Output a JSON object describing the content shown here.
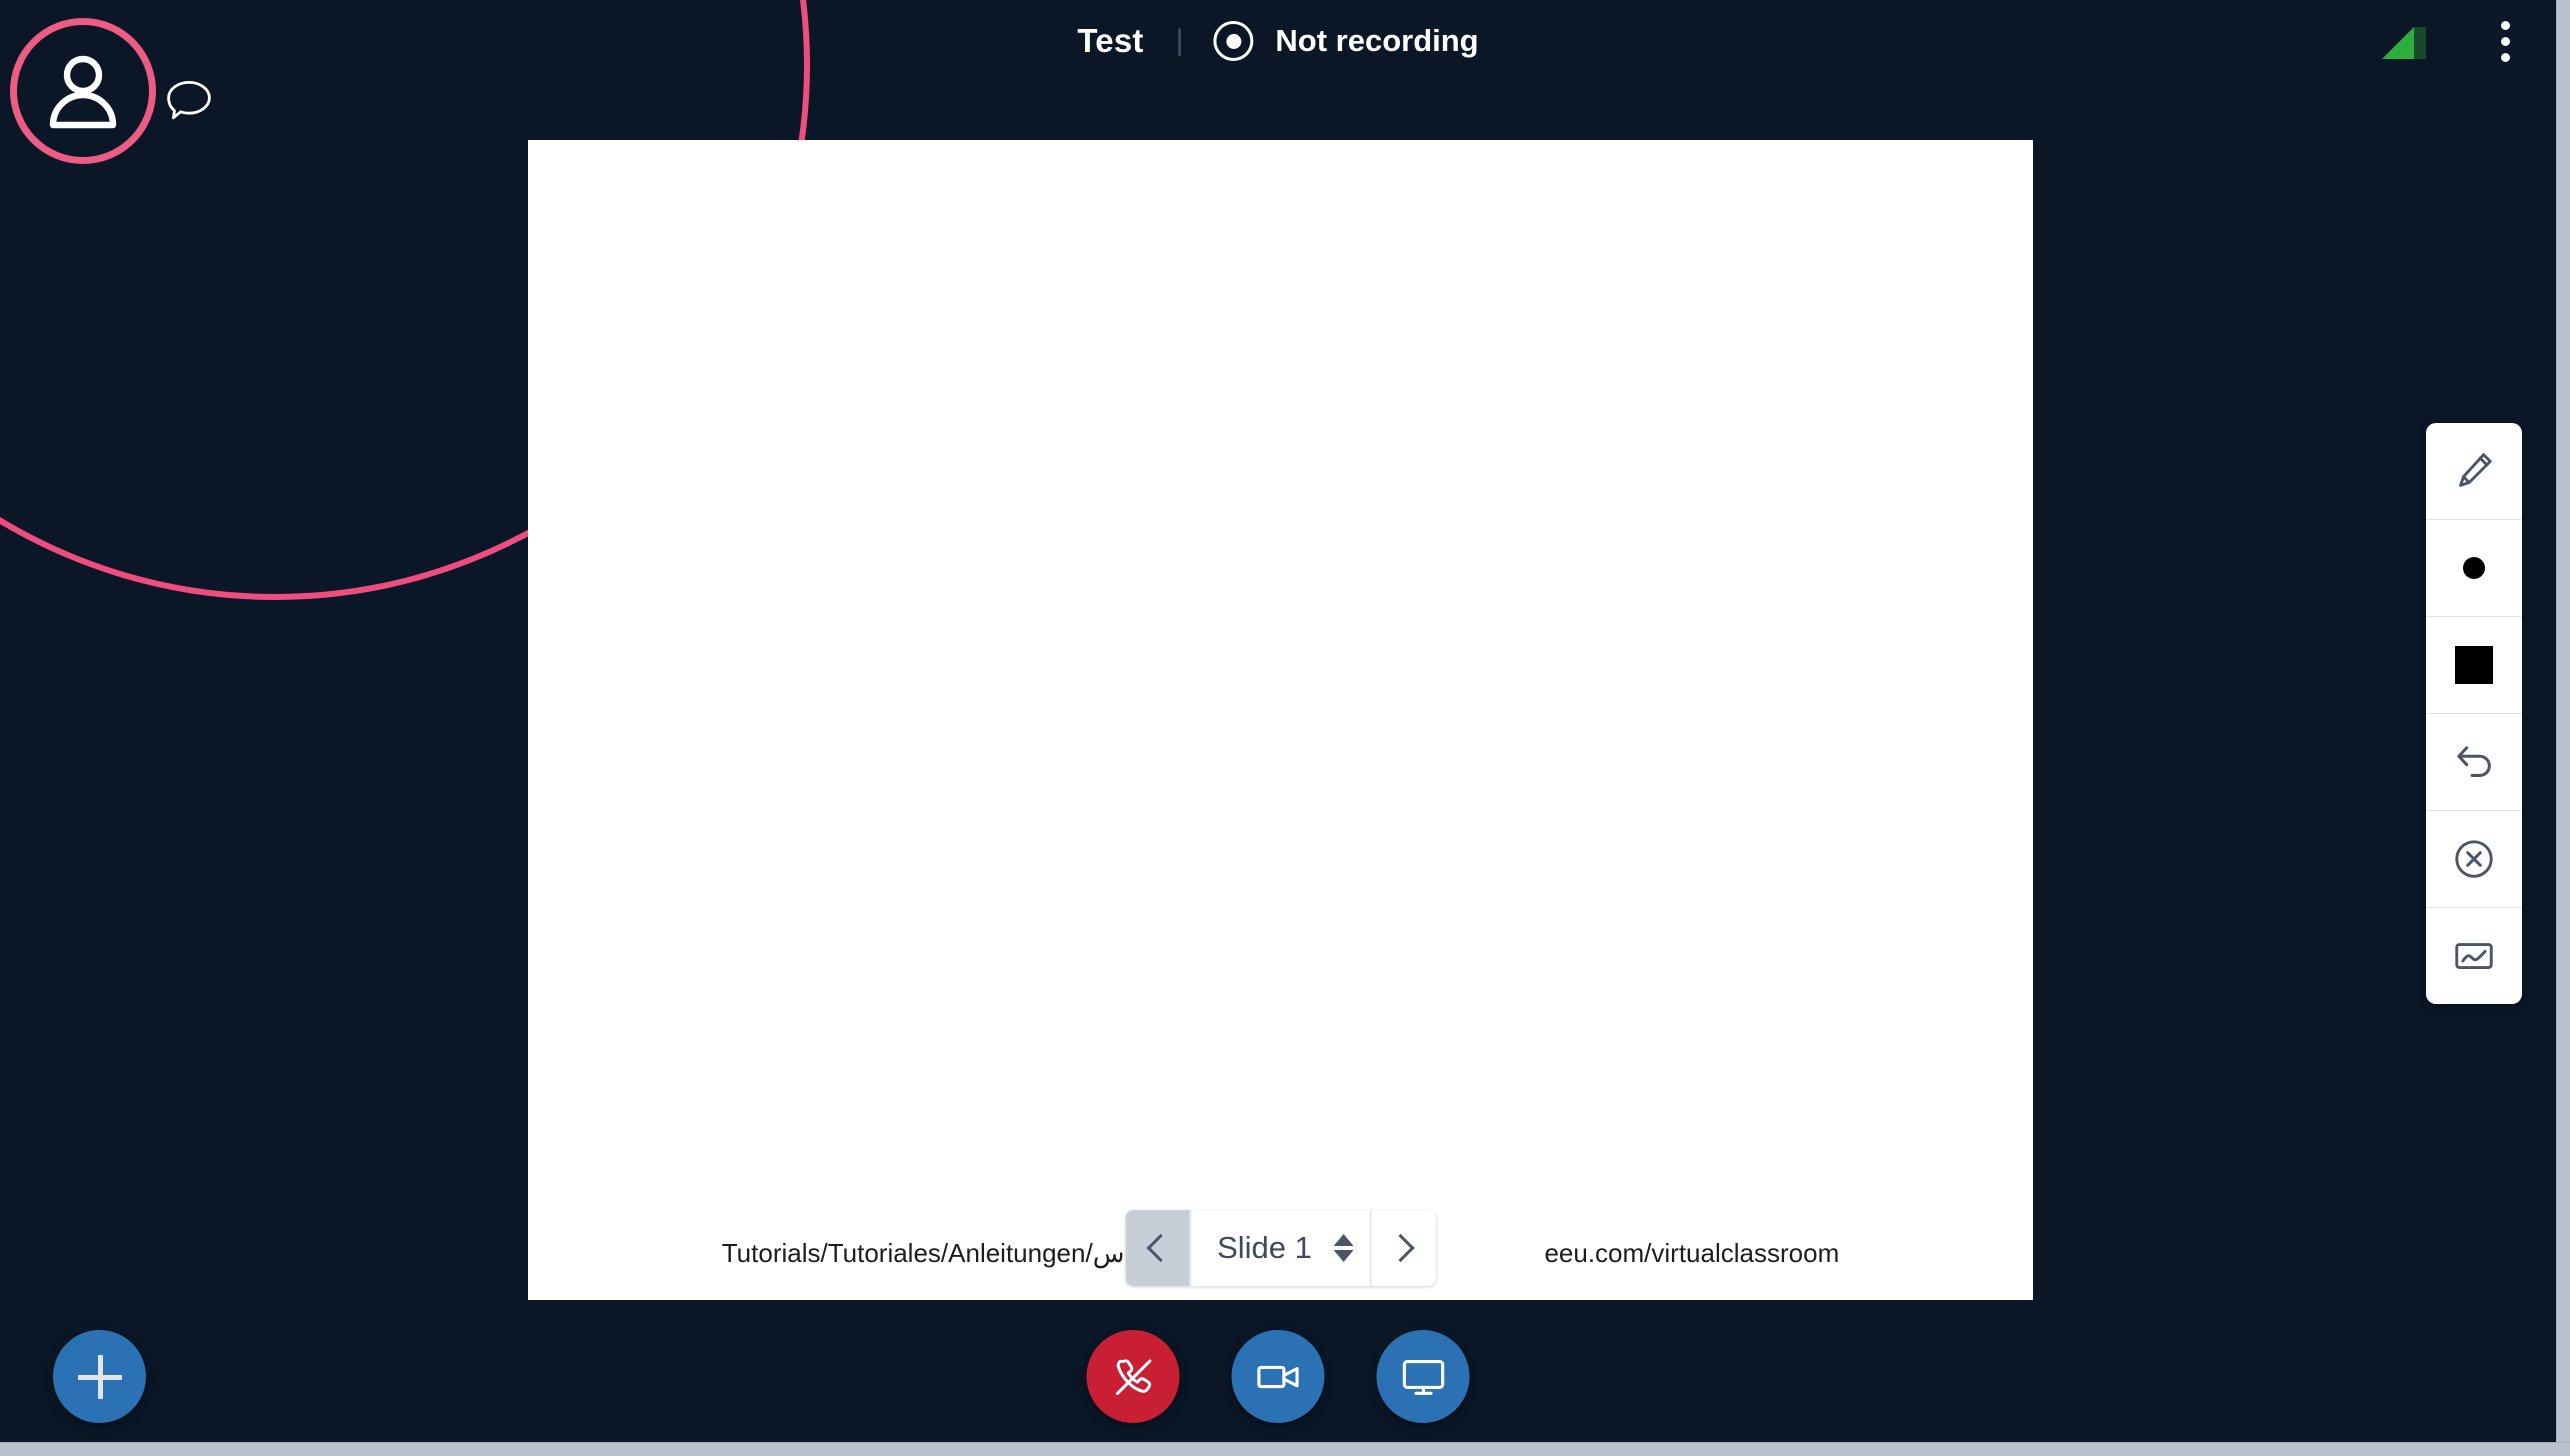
{
  "window": {
    "background_color": "#0b1727",
    "scrollbar_color": "#b9c2cc"
  },
  "header": {
    "meeting_title": "Test",
    "separator": "|",
    "recording_status": "Not recording",
    "recording_icon": "record-dot-icon",
    "signal_icon": "connection-signal-icon",
    "signal_color": "#2eae3c",
    "menu_icon": "kebab-menu-icon"
  },
  "user": {
    "avatar_icon": "person-icon",
    "avatar_ring_color": "#ed5c85",
    "chat_icon": "chat-bubble-icon"
  },
  "whiteboard": {
    "background_color": "#ffffff",
    "slide_text_left": "Tutorials/Tutoriales/Anleitungen/س",
    "slide_text_right": "eeu.com/virtualclassroom",
    "nav": {
      "prev_label": "Previous slide",
      "prev_icon": "chevron-left-icon",
      "next_label": "Next slide",
      "next_icon": "chevron-right-icon",
      "current_slide": "Slide 1",
      "stepper_icon": "up-down-stepper-icon"
    }
  },
  "toolbar": {
    "tools": [
      {
        "name": "pencil-tool",
        "icon": "pencil-icon",
        "label": "Pencil"
      },
      {
        "name": "thickness-tool",
        "icon": "dot-icon",
        "label": "Thickness",
        "value": "#000000"
      },
      {
        "name": "color-tool",
        "icon": "color-swatch-icon",
        "label": "Color",
        "value": "#000000"
      },
      {
        "name": "undo-tool",
        "icon": "undo-arrow-icon",
        "label": "Undo"
      },
      {
        "name": "clear-tool",
        "icon": "x-circle-icon",
        "label": "Clear all"
      },
      {
        "name": "whiteboard-tool",
        "icon": "whiteboard-icon",
        "label": "Whiteboard"
      }
    ]
  },
  "controls": {
    "add_label": "Add",
    "add_icon": "plus-icon",
    "add_color": "#2b72b4",
    "items": [
      {
        "name": "hangup-button",
        "icon": "phone-slash-icon",
        "label": "Leave audio",
        "color": "#c81f35"
      },
      {
        "name": "camera-button",
        "icon": "video-camera-icon",
        "label": "Share webcam",
        "color": "#2b72b4"
      },
      {
        "name": "screenshare-button",
        "icon": "monitor-icon",
        "label": "Share screen",
        "color": "#2b72b4"
      }
    ]
  }
}
